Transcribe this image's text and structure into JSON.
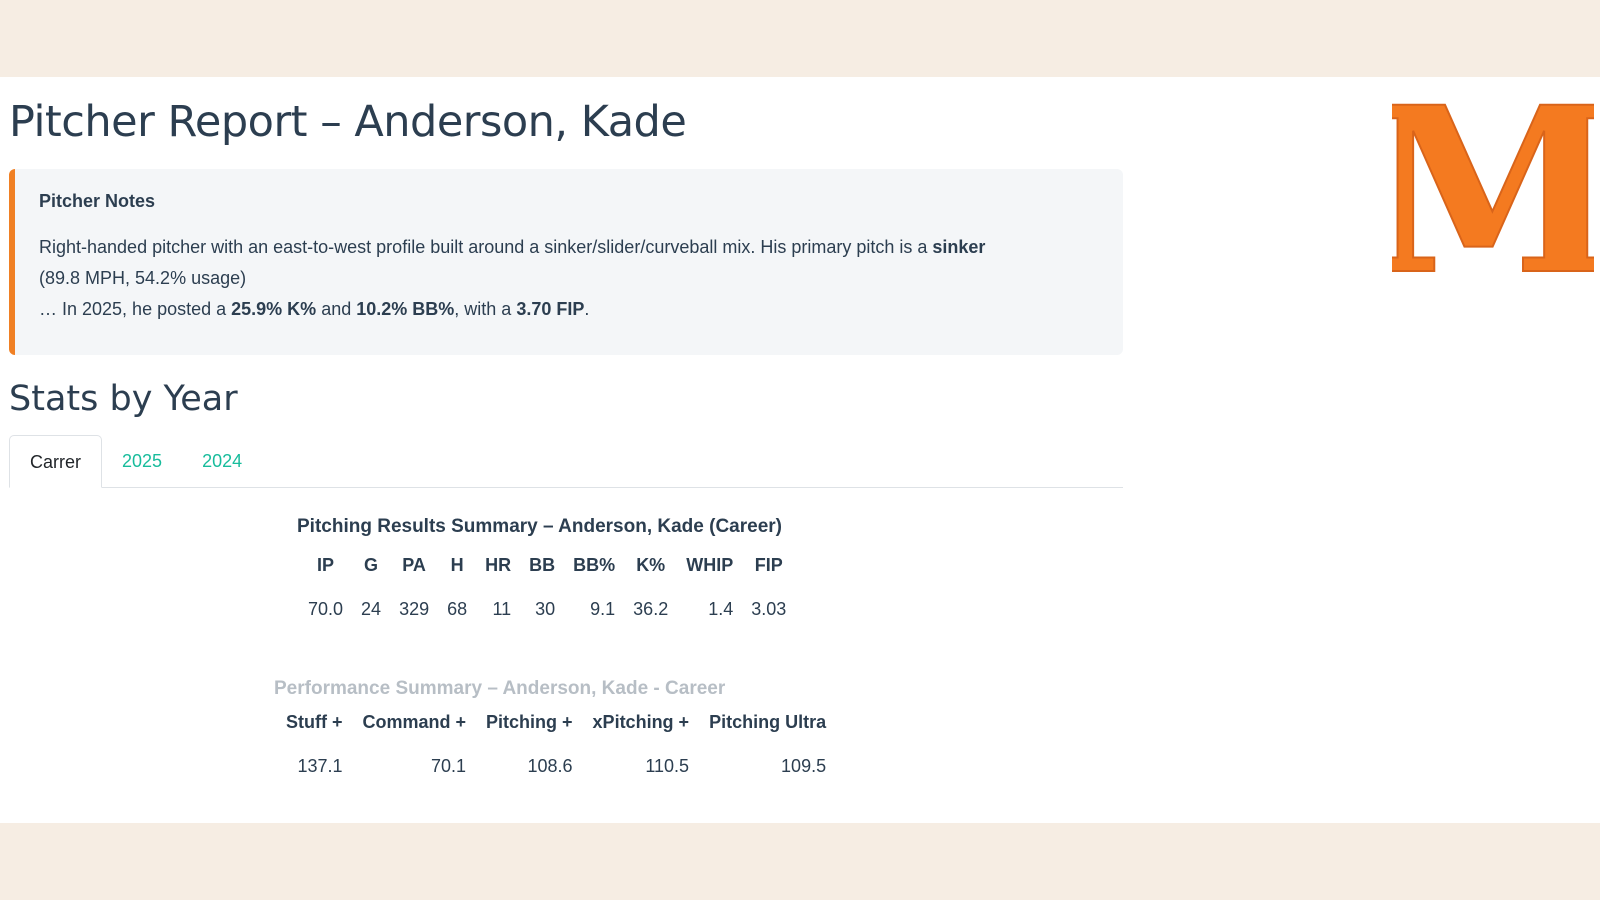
{
  "page": {
    "title": "Pitcher Report – Anderson, Kade"
  },
  "notes": {
    "heading": "Pitcher Notes",
    "line1_text": "Right-handed pitcher with an east-to-west profile built around a sinker/slider/curveball mix. His primary pitch is a ",
    "line1_bold": "sinker",
    "line2_text": "(89.8 MPH, 54.2% usage)",
    "line3_prefix": "… In 2025, he posted a ",
    "k_pct": "25.9% K%",
    "and_text": " and ",
    "bb_pct": "10.2% BB%",
    "with_text": ", with a ",
    "fip": "3.70 FIP",
    "end_text": "."
  },
  "stats_section": {
    "title": "Stats by Year",
    "tabs": [
      {
        "label": "Carrer",
        "active": true
      },
      {
        "label": "2025",
        "active": false
      },
      {
        "label": "2024",
        "active": false
      }
    ]
  },
  "pitching_results": {
    "title": "Pitching Results Summary – Anderson, Kade (Career)",
    "headers": [
      "IP",
      "G",
      "PA",
      "H",
      "HR",
      "BB",
      "BB%",
      "K%",
      "WHIP",
      "FIP"
    ],
    "rows": [
      [
        "70.0",
        "24",
        "329",
        "68",
        "11",
        "30",
        "9.1",
        "36.2",
        "1.4",
        "3.03"
      ]
    ]
  },
  "performance_summary": {
    "title": "Performance Summary – Anderson, Kade - Career",
    "headers": [
      "Stuff +",
      "Command +",
      "Pitching +",
      "xPitching +",
      "Pitching Ultra"
    ],
    "rows": [
      [
        "137.1",
        "70.1",
        "108.6",
        "110.5",
        "109.5"
      ]
    ]
  },
  "logo": {
    "glyph": "M",
    "color": "#f47a20"
  },
  "colors": {
    "accent_orange": "#f08024",
    "tab_link": "#18bc9c",
    "text_dark": "#2c3e50",
    "muted_title": "#b7bec5",
    "frame_background": "#f6ede3"
  }
}
